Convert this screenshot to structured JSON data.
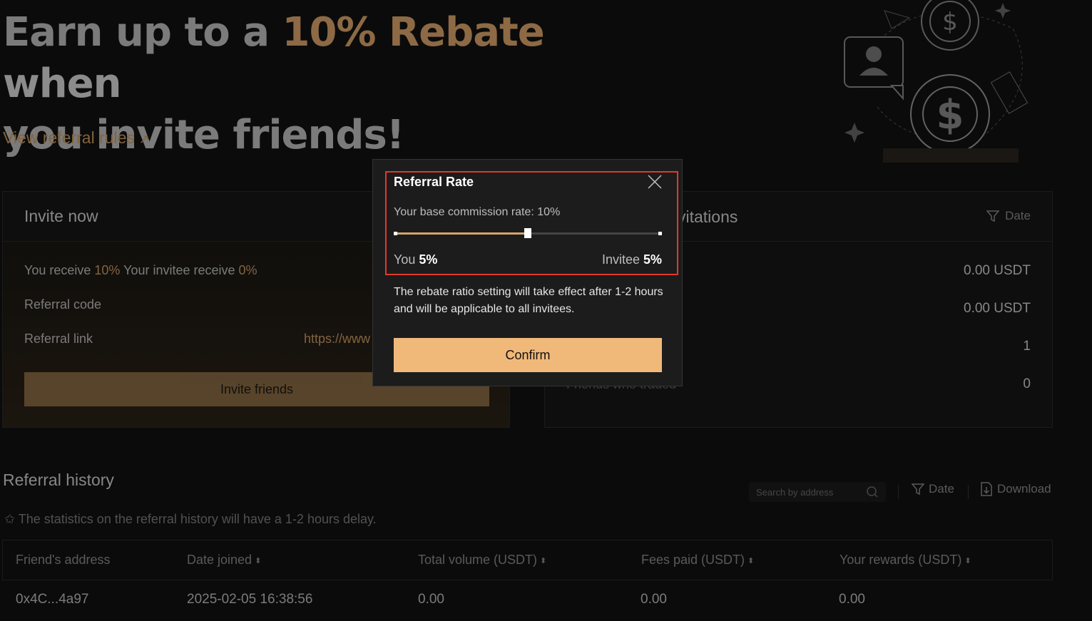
{
  "hero": {
    "title_part1": "Earn up to a ",
    "title_accent": "10% Rebate",
    "title_part2": " when",
    "title_line2": "you invite friends!",
    "rules_link": "View referral rules",
    "rules_arrow": "↗"
  },
  "invite": {
    "title": "Invite now",
    "you_receive_label": "You receive ",
    "you_receive_value": "10%",
    "invitee_receive_label": " Your invitee receive ",
    "invitee_receive_value": "0%",
    "referral_code_label": "Referral code",
    "referral_link_label": "Referral link",
    "referral_link_value": "https://www",
    "invite_button": "Invite friends"
  },
  "invitations": {
    "title": "vitations",
    "date_filter": "Date",
    "stats": [
      "0.00 USDT",
      "0.00 USDT",
      "1",
      "0"
    ],
    "friends_traded_label": "Friends who traded"
  },
  "history": {
    "title": "Referral history",
    "note": "The statistics on the referral history will have a 1-2 hours delay.",
    "note_star": "✩",
    "search_placeholder": "Search by address",
    "date_filter": "Date",
    "download": "Download",
    "columns": [
      "Friend's address",
      "Date joined",
      "Total volume (USDT)",
      "Fees paid (USDT)",
      "Your rewards (USDT)"
    ],
    "rows": [
      [
        "0x4C...4a97",
        "2025-02-05 16:38:56",
        "0.00",
        "0.00",
        "0.00"
      ]
    ]
  },
  "modal": {
    "title": "Referral Rate",
    "base_rate": "Your base commission rate: 10%",
    "slider_fraction": 0.5,
    "you_label": "You ",
    "you_value": "5%",
    "invitee_label": "Invitee ",
    "invitee_value": "5%",
    "note": "The rebate ratio setting will take effect after 1-2 hours and will be applicable to all invitees.",
    "confirm": "Confirm"
  },
  "colors": {
    "accent": "#d9a46b",
    "confirm": "#f0b97a",
    "highlight": "#e0392b"
  }
}
